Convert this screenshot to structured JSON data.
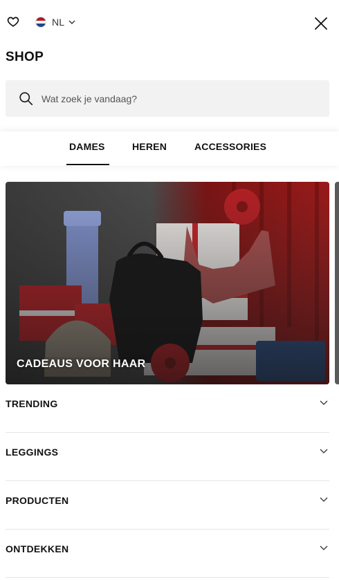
{
  "header": {
    "locale_code": "NL",
    "flag_colors": [
      "#ae1c28",
      "#ffffff",
      "#21468b"
    ],
    "wishlist_icon": "heart-icon",
    "close_icon": "close-icon"
  },
  "shop": {
    "title": "SHOP"
  },
  "search": {
    "placeholder": "Wat zoek je vandaag?",
    "value": "",
    "icon": "search-icon"
  },
  "tabs": [
    {
      "label": "DAMES",
      "active": true
    },
    {
      "label": "HEREN",
      "active": false
    },
    {
      "label": "ACCESSORIES",
      "active": false
    }
  ],
  "hero": {
    "label": "CADEAUS VOOR HAAR"
  },
  "accordion": [
    {
      "label": "TRENDING"
    },
    {
      "label": "LEGGINGS"
    },
    {
      "label": "PRODUCTEN"
    },
    {
      "label": "ONTDEKKEN"
    }
  ]
}
